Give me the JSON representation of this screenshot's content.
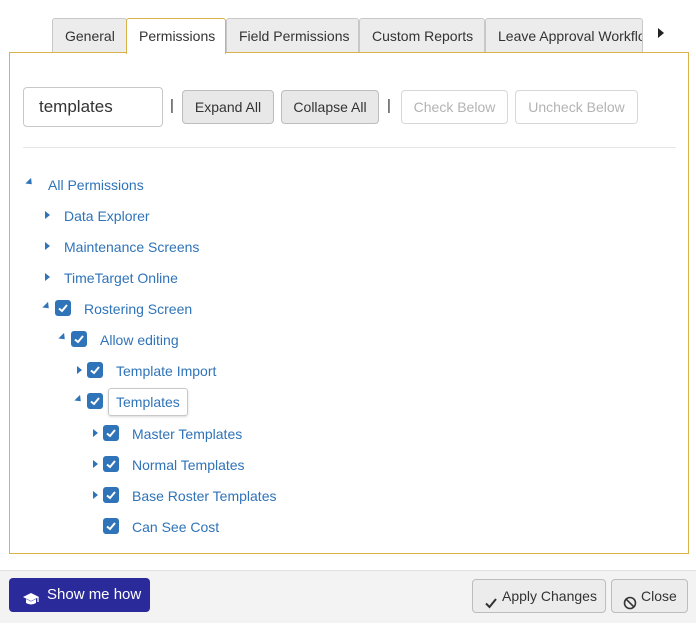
{
  "tabs": [
    {
      "label": "General",
      "active": false
    },
    {
      "label": "Permissions",
      "active": true
    },
    {
      "label": "Field Permissions",
      "active": false
    },
    {
      "label": "Custom Reports",
      "active": false
    },
    {
      "label": "Leave Approval Workflo",
      "active": false
    }
  ],
  "toolbar": {
    "search_value": "templates",
    "separator": "|",
    "expand_all": "Expand All",
    "collapse_all": "Collapse All",
    "check_below": "Check Below",
    "uncheck_below": "Uncheck Below"
  },
  "tree": [
    {
      "label": "All Permissions",
      "expanded": true,
      "checked": null
    },
    {
      "label": "Data Explorer",
      "expanded": false,
      "checked": null
    },
    {
      "label": "Maintenance Screens",
      "expanded": false,
      "checked": null
    },
    {
      "label": "TimeTarget Online",
      "expanded": false,
      "checked": null
    },
    {
      "label": "Rostering Screen",
      "expanded": true,
      "checked": true
    },
    {
      "label": "Allow editing",
      "expanded": true,
      "checked": true
    },
    {
      "label": "Template Import",
      "expanded": false,
      "checked": true
    },
    {
      "label": "Templates",
      "expanded": true,
      "checked": true,
      "selected": true
    },
    {
      "label": "Master Templates",
      "expanded": false,
      "checked": true
    },
    {
      "label": "Normal Templates",
      "expanded": false,
      "checked": true
    },
    {
      "label": "Base Roster Templates",
      "expanded": false,
      "checked": true
    },
    {
      "label": "Can See Cost",
      "expanded": null,
      "checked": true
    }
  ],
  "footer": {
    "show_me_how": "Show me how",
    "apply_changes": "Apply Changes",
    "close": "Close"
  },
  "colors": {
    "accent_blue": "#2f73b8",
    "panel_border": "#d9b24c",
    "show_me_how_bg": "#2a2a9a"
  },
  "icons": {
    "show_me_how": "graduation-cap-icon",
    "apply": "checkmark-icon",
    "close": "no-entry-icon"
  }
}
